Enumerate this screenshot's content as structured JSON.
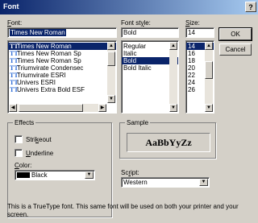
{
  "window": {
    "title": "Font",
    "help_label": "?"
  },
  "font": {
    "label": "Font:",
    "value": "Times New Roman",
    "items": [
      {
        "name": "Times New Roman",
        "selected": true
      },
      {
        "name": "Times New Roman Sp",
        "selected": false
      },
      {
        "name": "Times New Roman Sp",
        "selected": false
      },
      {
        "name": "Triumvirate Condensec",
        "selected": false
      },
      {
        "name": "Triumvirate ESRI",
        "selected": false
      },
      {
        "name": "Univers ESRI",
        "selected": false
      },
      {
        "name": "Univers Extra Bold ESF",
        "selected": false
      }
    ]
  },
  "style": {
    "label": "Font style:",
    "value": "Bold",
    "items": [
      {
        "name": "Regular",
        "selected": false
      },
      {
        "name": "Italic",
        "selected": false
      },
      {
        "name": "Bold",
        "selected": true
      },
      {
        "name": "Bold Italic",
        "selected": false
      }
    ]
  },
  "size": {
    "label": "Size:",
    "value": "14",
    "items": [
      {
        "name": "14",
        "selected": true
      },
      {
        "name": "16",
        "selected": false
      },
      {
        "name": "18",
        "selected": false
      },
      {
        "name": "20",
        "selected": false
      },
      {
        "name": "22",
        "selected": false
      },
      {
        "name": "24",
        "selected": false
      },
      {
        "name": "26",
        "selected": false
      }
    ]
  },
  "buttons": {
    "ok": "OK",
    "cancel": "Cancel"
  },
  "effects": {
    "title": "Effects",
    "strikeout": "Strikeout",
    "underline": "Underline",
    "color_label": "Color:",
    "color_value": "Black",
    "color_hex": "#000000"
  },
  "sample": {
    "title": "Sample",
    "text": "AaBbYyZz"
  },
  "script": {
    "label": "Script:",
    "value": "Western"
  },
  "description": "This is a TrueType font. This same font will be used on both your printer and your screen.",
  "icons": {
    "truetype": "TT"
  },
  "colors": {
    "selection": "#0a246a",
    "title_start": "#0a246a",
    "title_end": "#a6caf0"
  }
}
